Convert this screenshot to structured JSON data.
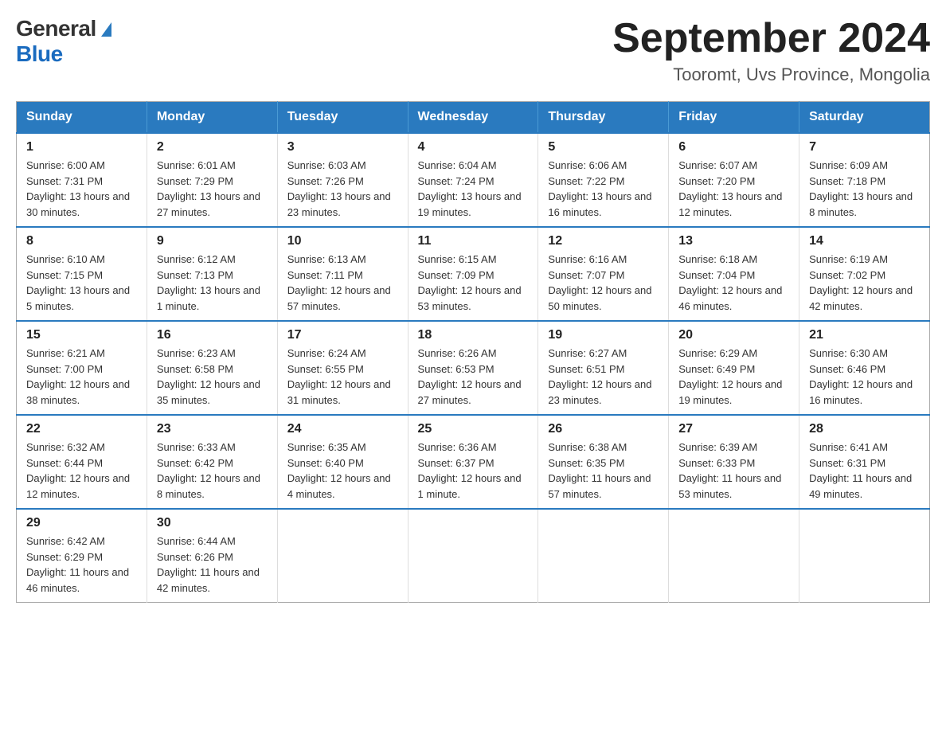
{
  "logo": {
    "general": "General",
    "blue": "Blue"
  },
  "title": "September 2024",
  "location": "Tooromt, Uvs Province, Mongolia",
  "days_of_week": [
    "Sunday",
    "Monday",
    "Tuesday",
    "Wednesday",
    "Thursday",
    "Friday",
    "Saturday"
  ],
  "weeks": [
    [
      {
        "day": "1",
        "sunrise": "6:00 AM",
        "sunset": "7:31 PM",
        "daylight": "13 hours and 30 minutes."
      },
      {
        "day": "2",
        "sunrise": "6:01 AM",
        "sunset": "7:29 PM",
        "daylight": "13 hours and 27 minutes."
      },
      {
        "day": "3",
        "sunrise": "6:03 AM",
        "sunset": "7:26 PM",
        "daylight": "13 hours and 23 minutes."
      },
      {
        "day": "4",
        "sunrise": "6:04 AM",
        "sunset": "7:24 PM",
        "daylight": "13 hours and 19 minutes."
      },
      {
        "day": "5",
        "sunrise": "6:06 AM",
        "sunset": "7:22 PM",
        "daylight": "13 hours and 16 minutes."
      },
      {
        "day": "6",
        "sunrise": "6:07 AM",
        "sunset": "7:20 PM",
        "daylight": "13 hours and 12 minutes."
      },
      {
        "day": "7",
        "sunrise": "6:09 AM",
        "sunset": "7:18 PM",
        "daylight": "13 hours and 8 minutes."
      }
    ],
    [
      {
        "day": "8",
        "sunrise": "6:10 AM",
        "sunset": "7:15 PM",
        "daylight": "13 hours and 5 minutes."
      },
      {
        "day": "9",
        "sunrise": "6:12 AM",
        "sunset": "7:13 PM",
        "daylight": "13 hours and 1 minute."
      },
      {
        "day": "10",
        "sunrise": "6:13 AM",
        "sunset": "7:11 PM",
        "daylight": "12 hours and 57 minutes."
      },
      {
        "day": "11",
        "sunrise": "6:15 AM",
        "sunset": "7:09 PM",
        "daylight": "12 hours and 53 minutes."
      },
      {
        "day": "12",
        "sunrise": "6:16 AM",
        "sunset": "7:07 PM",
        "daylight": "12 hours and 50 minutes."
      },
      {
        "day": "13",
        "sunrise": "6:18 AM",
        "sunset": "7:04 PM",
        "daylight": "12 hours and 46 minutes."
      },
      {
        "day": "14",
        "sunrise": "6:19 AM",
        "sunset": "7:02 PM",
        "daylight": "12 hours and 42 minutes."
      }
    ],
    [
      {
        "day": "15",
        "sunrise": "6:21 AM",
        "sunset": "7:00 PM",
        "daylight": "12 hours and 38 minutes."
      },
      {
        "day": "16",
        "sunrise": "6:23 AM",
        "sunset": "6:58 PM",
        "daylight": "12 hours and 35 minutes."
      },
      {
        "day": "17",
        "sunrise": "6:24 AM",
        "sunset": "6:55 PM",
        "daylight": "12 hours and 31 minutes."
      },
      {
        "day": "18",
        "sunrise": "6:26 AM",
        "sunset": "6:53 PM",
        "daylight": "12 hours and 27 minutes."
      },
      {
        "day": "19",
        "sunrise": "6:27 AM",
        "sunset": "6:51 PM",
        "daylight": "12 hours and 23 minutes."
      },
      {
        "day": "20",
        "sunrise": "6:29 AM",
        "sunset": "6:49 PM",
        "daylight": "12 hours and 19 minutes."
      },
      {
        "day": "21",
        "sunrise": "6:30 AM",
        "sunset": "6:46 PM",
        "daylight": "12 hours and 16 minutes."
      }
    ],
    [
      {
        "day": "22",
        "sunrise": "6:32 AM",
        "sunset": "6:44 PM",
        "daylight": "12 hours and 12 minutes."
      },
      {
        "day": "23",
        "sunrise": "6:33 AM",
        "sunset": "6:42 PM",
        "daylight": "12 hours and 8 minutes."
      },
      {
        "day": "24",
        "sunrise": "6:35 AM",
        "sunset": "6:40 PM",
        "daylight": "12 hours and 4 minutes."
      },
      {
        "day": "25",
        "sunrise": "6:36 AM",
        "sunset": "6:37 PM",
        "daylight": "12 hours and 1 minute."
      },
      {
        "day": "26",
        "sunrise": "6:38 AM",
        "sunset": "6:35 PM",
        "daylight": "11 hours and 57 minutes."
      },
      {
        "day": "27",
        "sunrise": "6:39 AM",
        "sunset": "6:33 PM",
        "daylight": "11 hours and 53 minutes."
      },
      {
        "day": "28",
        "sunrise": "6:41 AM",
        "sunset": "6:31 PM",
        "daylight": "11 hours and 49 minutes."
      }
    ],
    [
      {
        "day": "29",
        "sunrise": "6:42 AM",
        "sunset": "6:29 PM",
        "daylight": "11 hours and 46 minutes."
      },
      {
        "day": "30",
        "sunrise": "6:44 AM",
        "sunset": "6:26 PM",
        "daylight": "11 hours and 42 minutes."
      },
      null,
      null,
      null,
      null,
      null
    ]
  ]
}
